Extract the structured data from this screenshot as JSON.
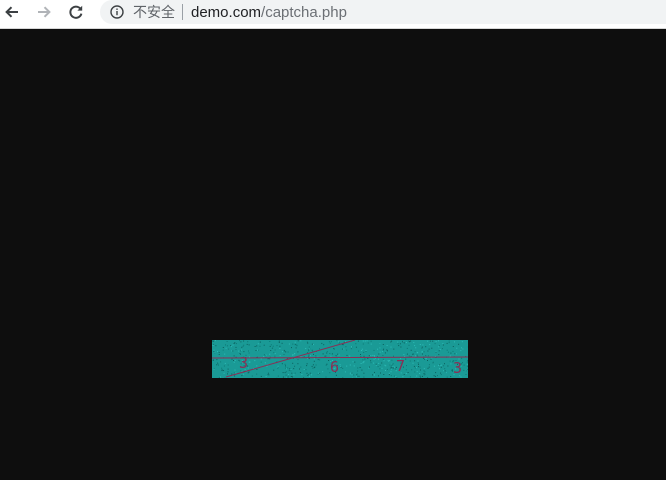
{
  "browser": {
    "security_label": "不安全",
    "url_domain": "demo.com",
    "url_path": "/captcha.php",
    "icons": {
      "back": "arrow-left-icon",
      "forward": "arrow-right-icon",
      "reload": "reload-icon",
      "info": "info-icon"
    }
  },
  "page": {
    "background": "#0e0e0e"
  },
  "captcha": {
    "characters": [
      "3",
      "6",
      "7",
      "3"
    ],
    "background_color": "#1a9a96",
    "noise_color": "#0b5e5b",
    "text_color": "#8a2f55",
    "line_color": "#8a2f55"
  }
}
